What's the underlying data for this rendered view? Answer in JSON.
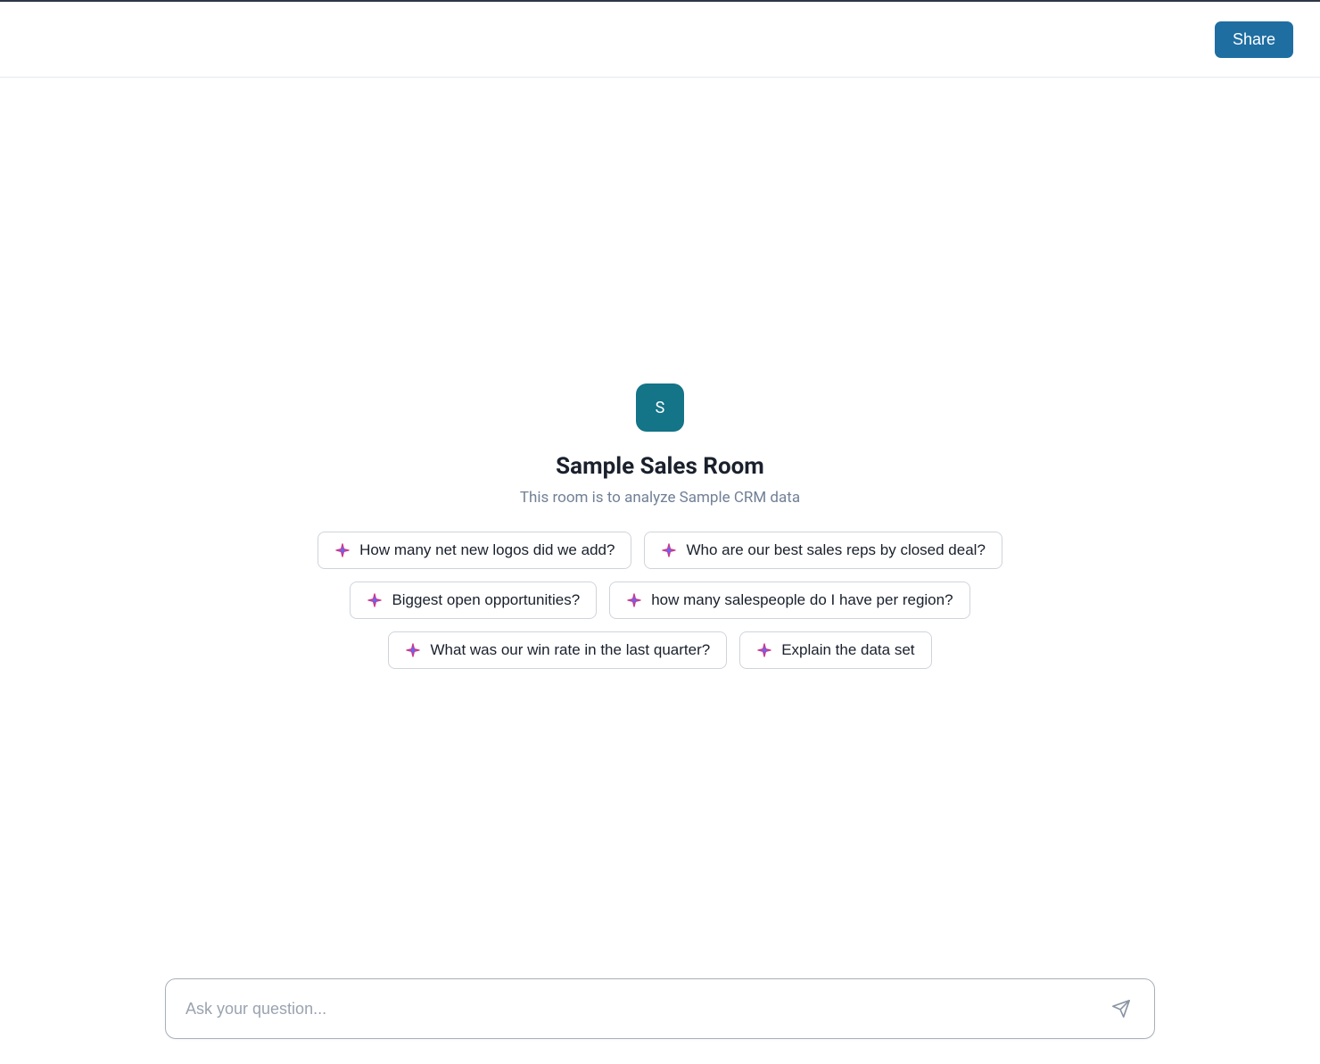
{
  "header": {
    "share_label": "Share"
  },
  "room": {
    "avatar_letter": "S",
    "title": "Sample Sales Room",
    "subtitle": "This room is to analyze Sample CRM data"
  },
  "suggestions": [
    "How many net new logos did we add?",
    "Who are our best sales reps by closed deal?",
    "Biggest open opportunities?",
    "how many salespeople do I have per region?",
    "What was our win rate in the last quarter?",
    "Explain the data set"
  ],
  "input": {
    "placeholder": "Ask your question...",
    "value": ""
  },
  "colors": {
    "accent": "#1e6ea2",
    "avatar_bg": "#147488"
  }
}
